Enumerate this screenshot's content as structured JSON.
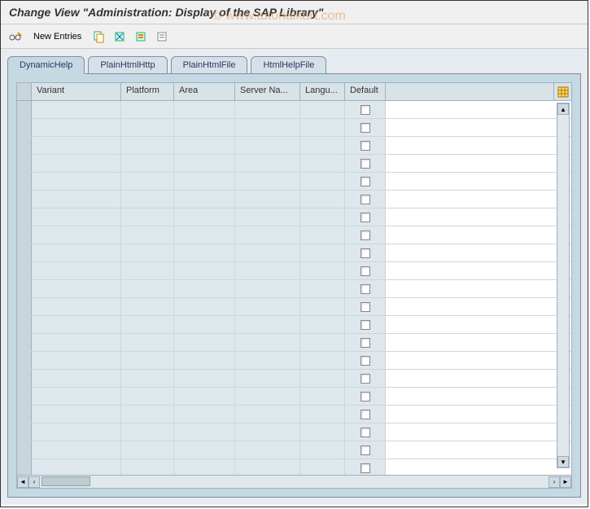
{
  "title": "Change View \"Administration: Display of the SAP Library\"",
  "watermark": "© www.tutorialkart.com",
  "toolbar": {
    "new_entries_label": "New Entries"
  },
  "tabs": [
    {
      "label": "DynamicHelp",
      "active": true
    },
    {
      "label": "PlainHtmlHttp",
      "active": false
    },
    {
      "label": "PlainHtmlFile",
      "active": false
    },
    {
      "label": "HtmlHelpFile",
      "active": false
    }
  ],
  "columns": {
    "variant": "Variant",
    "platform": "Platform",
    "area": "Area",
    "server": "Server Na...",
    "language": "Langu...",
    "default": "Default"
  },
  "rows": [
    {
      "variant": "",
      "platform": "",
      "area": "",
      "server": "",
      "language": "",
      "default": false
    },
    {
      "variant": "",
      "platform": "",
      "area": "",
      "server": "",
      "language": "",
      "default": false
    },
    {
      "variant": "",
      "platform": "",
      "area": "",
      "server": "",
      "language": "",
      "default": false
    },
    {
      "variant": "",
      "platform": "",
      "area": "",
      "server": "",
      "language": "",
      "default": false
    },
    {
      "variant": "",
      "platform": "",
      "area": "",
      "server": "",
      "language": "",
      "default": false
    },
    {
      "variant": "",
      "platform": "",
      "area": "",
      "server": "",
      "language": "",
      "default": false
    },
    {
      "variant": "",
      "platform": "",
      "area": "",
      "server": "",
      "language": "",
      "default": false
    },
    {
      "variant": "",
      "platform": "",
      "area": "",
      "server": "",
      "language": "",
      "default": false
    },
    {
      "variant": "",
      "platform": "",
      "area": "",
      "server": "",
      "language": "",
      "default": false
    },
    {
      "variant": "",
      "platform": "",
      "area": "",
      "server": "",
      "language": "",
      "default": false
    },
    {
      "variant": "",
      "platform": "",
      "area": "",
      "server": "",
      "language": "",
      "default": false
    },
    {
      "variant": "",
      "platform": "",
      "area": "",
      "server": "",
      "language": "",
      "default": false
    },
    {
      "variant": "",
      "platform": "",
      "area": "",
      "server": "",
      "language": "",
      "default": false
    },
    {
      "variant": "",
      "platform": "",
      "area": "",
      "server": "",
      "language": "",
      "default": false
    },
    {
      "variant": "",
      "platform": "",
      "area": "",
      "server": "",
      "language": "",
      "default": false
    },
    {
      "variant": "",
      "platform": "",
      "area": "",
      "server": "",
      "language": "",
      "default": false
    },
    {
      "variant": "",
      "platform": "",
      "area": "",
      "server": "",
      "language": "",
      "default": false
    },
    {
      "variant": "",
      "platform": "",
      "area": "",
      "server": "",
      "language": "",
      "default": false
    },
    {
      "variant": "",
      "platform": "",
      "area": "",
      "server": "",
      "language": "",
      "default": false
    },
    {
      "variant": "",
      "platform": "",
      "area": "",
      "server": "",
      "language": "",
      "default": false
    },
    {
      "variant": "",
      "platform": "",
      "area": "",
      "server": "",
      "language": "",
      "default": false
    }
  ]
}
